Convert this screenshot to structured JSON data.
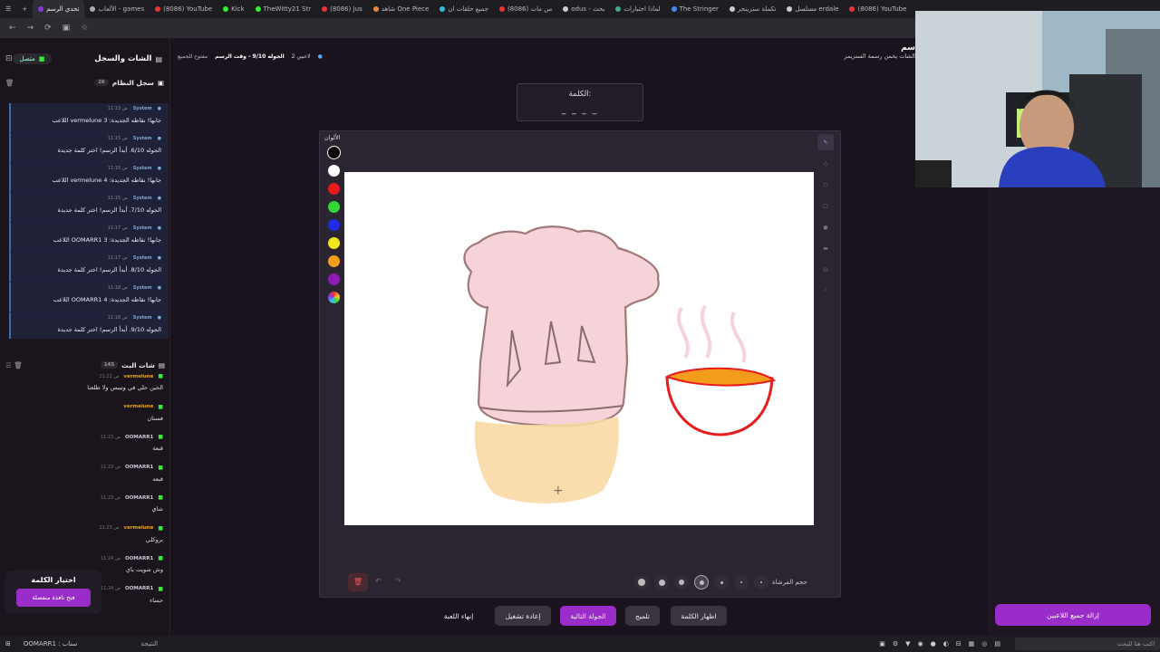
{
  "tabs": [
    {
      "label": "تحدي الرسم",
      "active": true
    },
    {
      "label": "الألعاب - games"
    },
    {
      "label": "(8086) YouTube"
    },
    {
      "label": "Kick"
    },
    {
      "label": "TheWitty21 Str"
    },
    {
      "label": "(8086) Jus"
    },
    {
      "label": "شاهد One Piece"
    },
    {
      "label": "جميع حلقات ان"
    },
    {
      "label": "(8086) من مات"
    },
    {
      "label": "odus - بحث"
    },
    {
      "label": "لماذا اختبارات"
    },
    {
      "label": "The Stringer"
    },
    {
      "label": "تكملة سترينجر"
    },
    {
      "label": "مسلسل erdale"
    },
    {
      "label": "(8086) YouTube"
    }
  ],
  "sidebar": {
    "title": "الشات والسجل",
    "status": "متصل",
    "system_log": {
      "title": "سجل النظام",
      "count": "26",
      "items": [
        {
          "user": "System",
          "time": "11:13 ص",
          "text": "اللاعب vermelune جابها! نقاطه الجديدة: 3"
        },
        {
          "user": "System",
          "time": "11:15 ص",
          "text": "الجوله 6/10. أبدأ الرسم! اختر كلمة جديدة"
        },
        {
          "user": "System",
          "time": "11:15 ص",
          "text": "اللاعب vermelune جابها! نقاطه الجديدة: 4"
        },
        {
          "user": "System",
          "time": "11:15 ص",
          "text": "الجوله 7/10. أبدأ الرسم! اختر كلمة جديدة"
        },
        {
          "user": "System",
          "time": "11:17 ص",
          "text": "اللاعب OOMARR1 جابها! نقاطه الجديدة: 3"
        },
        {
          "user": "System",
          "time": "11:17 ص",
          "text": "الجوله 8/10. أبدأ الرسم! اختر كلمة جديدة"
        },
        {
          "user": "System",
          "time": "11:18 ص",
          "text": "اللاعب OOMARR1 جابها! نقاطه الجديدة: 4"
        },
        {
          "user": "System",
          "time": "11:18 ص",
          "text": "الجوله 9/10. أبدأ الرسم! اختر كلمة جديدة"
        }
      ]
    },
    "stream_chat": {
      "title": "شات البث",
      "count": "145",
      "items": [
        {
          "user": "vermelune",
          "time": "11:22 ص",
          "text": "الحين حلي في وتيبس ولا طلعنا",
          "color": "#e6a817"
        },
        {
          "user": "vermelune",
          "time": "",
          "text": "فستان",
          "color": "#e6a817"
        },
        {
          "user": "OOMARR1",
          "time": "11:23 ص",
          "text": "قبعة",
          "color": "#c9c9d6"
        },
        {
          "user": "OOMARR1",
          "time": "11:23 ص",
          "text": "قبعه",
          "color": "#c9c9d6"
        },
        {
          "user": "OOMARR1",
          "time": "11:23 ص",
          "text": "شاي",
          "color": "#c9c9d6"
        },
        {
          "user": "vermelune",
          "time": "11:23 ص",
          "text": "بروكلي",
          "color": "#e6a817"
        },
        {
          "user": "OOMARR1",
          "time": "11:24 ص",
          "text": "وش شويت باي",
          "color": "#c9c9d6"
        },
        {
          "user": "OOMARR1",
          "time": "11:24 ص",
          "text": "حساء",
          "color": "#c9c9d6"
        }
      ]
    },
    "word_pick": {
      "title": "اختيار الكلمة",
      "button": "فتح نافذة منفصلة"
    }
  },
  "status": {
    "players": "2 لاعبين",
    "round": "الجوله 9/10 - وقت الرسم",
    "mode": "مفتوح للجميع"
  },
  "header_right": {
    "title": "سم",
    "subtitle": "الشات يخمن رسمة الستريمر"
  },
  "word": {
    "label": "الكلمة:",
    "hint": "_ _ _ _"
  },
  "colors_label": "الألوان",
  "palette": [
    "#000000",
    "#ffffff",
    "#e81c1c",
    "#33d633",
    "#1c2ce8",
    "#f4e61c",
    "#f49c1c",
    "#8c1cb4",
    "rainbow"
  ],
  "brush_label": "حجم الفرشاة",
  "controls": {
    "end": "إنهاء اللعبة",
    "restart": "إعادة تشغيل",
    "next": "الجولة التالية",
    "hint": "تلميح",
    "show_word": "اظهار الكلمة"
  },
  "kick_all": "إزالة جميع اللاعبين",
  "taskbar": {
    "app": "OOMARR1 : سناب",
    "search": "اكتب هنا للبحث",
    "weather": "النتيجة"
  }
}
